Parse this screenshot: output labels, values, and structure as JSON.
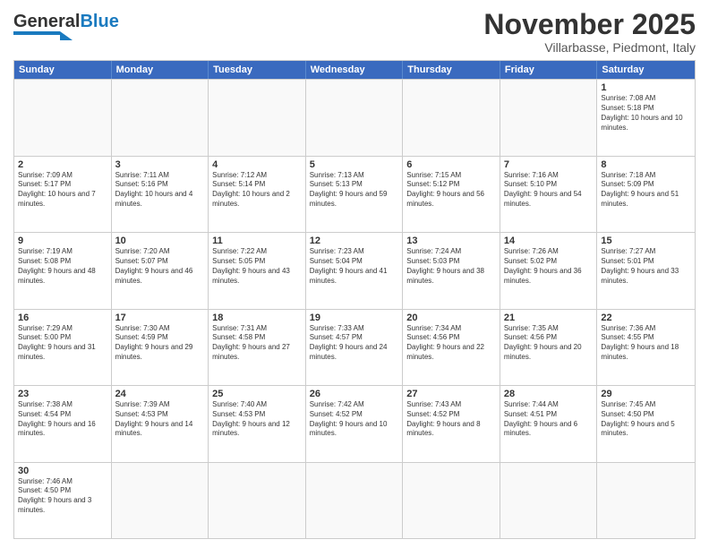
{
  "header": {
    "logo_text_general": "General",
    "logo_text_blue": "Blue",
    "month_title": "November 2025",
    "location": "Villarbasse, Piedmont, Italy"
  },
  "weekdays": [
    "Sunday",
    "Monday",
    "Tuesday",
    "Wednesday",
    "Thursday",
    "Friday",
    "Saturday"
  ],
  "weeks": [
    [
      {
        "day": "",
        "info": ""
      },
      {
        "day": "",
        "info": ""
      },
      {
        "day": "",
        "info": ""
      },
      {
        "day": "",
        "info": ""
      },
      {
        "day": "",
        "info": ""
      },
      {
        "day": "",
        "info": ""
      },
      {
        "day": "1",
        "info": "Sunrise: 7:08 AM\nSunset: 5:18 PM\nDaylight: 10 hours and 10 minutes."
      }
    ],
    [
      {
        "day": "2",
        "info": "Sunrise: 7:09 AM\nSunset: 5:17 PM\nDaylight: 10 hours and 7 minutes."
      },
      {
        "day": "3",
        "info": "Sunrise: 7:11 AM\nSunset: 5:16 PM\nDaylight: 10 hours and 4 minutes."
      },
      {
        "day": "4",
        "info": "Sunrise: 7:12 AM\nSunset: 5:14 PM\nDaylight: 10 hours and 2 minutes."
      },
      {
        "day": "5",
        "info": "Sunrise: 7:13 AM\nSunset: 5:13 PM\nDaylight: 9 hours and 59 minutes."
      },
      {
        "day": "6",
        "info": "Sunrise: 7:15 AM\nSunset: 5:12 PM\nDaylight: 9 hours and 56 minutes."
      },
      {
        "day": "7",
        "info": "Sunrise: 7:16 AM\nSunset: 5:10 PM\nDaylight: 9 hours and 54 minutes."
      },
      {
        "day": "8",
        "info": "Sunrise: 7:18 AM\nSunset: 5:09 PM\nDaylight: 9 hours and 51 minutes."
      }
    ],
    [
      {
        "day": "9",
        "info": "Sunrise: 7:19 AM\nSunset: 5:08 PM\nDaylight: 9 hours and 48 minutes."
      },
      {
        "day": "10",
        "info": "Sunrise: 7:20 AM\nSunset: 5:07 PM\nDaylight: 9 hours and 46 minutes."
      },
      {
        "day": "11",
        "info": "Sunrise: 7:22 AM\nSunset: 5:05 PM\nDaylight: 9 hours and 43 minutes."
      },
      {
        "day": "12",
        "info": "Sunrise: 7:23 AM\nSunset: 5:04 PM\nDaylight: 9 hours and 41 minutes."
      },
      {
        "day": "13",
        "info": "Sunrise: 7:24 AM\nSunset: 5:03 PM\nDaylight: 9 hours and 38 minutes."
      },
      {
        "day": "14",
        "info": "Sunrise: 7:26 AM\nSunset: 5:02 PM\nDaylight: 9 hours and 36 minutes."
      },
      {
        "day": "15",
        "info": "Sunrise: 7:27 AM\nSunset: 5:01 PM\nDaylight: 9 hours and 33 minutes."
      }
    ],
    [
      {
        "day": "16",
        "info": "Sunrise: 7:29 AM\nSunset: 5:00 PM\nDaylight: 9 hours and 31 minutes."
      },
      {
        "day": "17",
        "info": "Sunrise: 7:30 AM\nSunset: 4:59 PM\nDaylight: 9 hours and 29 minutes."
      },
      {
        "day": "18",
        "info": "Sunrise: 7:31 AM\nSunset: 4:58 PM\nDaylight: 9 hours and 27 minutes."
      },
      {
        "day": "19",
        "info": "Sunrise: 7:33 AM\nSunset: 4:57 PM\nDaylight: 9 hours and 24 minutes."
      },
      {
        "day": "20",
        "info": "Sunrise: 7:34 AM\nSunset: 4:56 PM\nDaylight: 9 hours and 22 minutes."
      },
      {
        "day": "21",
        "info": "Sunrise: 7:35 AM\nSunset: 4:56 PM\nDaylight: 9 hours and 20 minutes."
      },
      {
        "day": "22",
        "info": "Sunrise: 7:36 AM\nSunset: 4:55 PM\nDaylight: 9 hours and 18 minutes."
      }
    ],
    [
      {
        "day": "23",
        "info": "Sunrise: 7:38 AM\nSunset: 4:54 PM\nDaylight: 9 hours and 16 minutes."
      },
      {
        "day": "24",
        "info": "Sunrise: 7:39 AM\nSunset: 4:53 PM\nDaylight: 9 hours and 14 minutes."
      },
      {
        "day": "25",
        "info": "Sunrise: 7:40 AM\nSunset: 4:53 PM\nDaylight: 9 hours and 12 minutes."
      },
      {
        "day": "26",
        "info": "Sunrise: 7:42 AM\nSunset: 4:52 PM\nDaylight: 9 hours and 10 minutes."
      },
      {
        "day": "27",
        "info": "Sunrise: 7:43 AM\nSunset: 4:52 PM\nDaylight: 9 hours and 8 minutes."
      },
      {
        "day": "28",
        "info": "Sunrise: 7:44 AM\nSunset: 4:51 PM\nDaylight: 9 hours and 6 minutes."
      },
      {
        "day": "29",
        "info": "Sunrise: 7:45 AM\nSunset: 4:50 PM\nDaylight: 9 hours and 5 minutes."
      }
    ],
    [
      {
        "day": "30",
        "info": "Sunrise: 7:46 AM\nSunset: 4:50 PM\nDaylight: 9 hours and 3 minutes."
      },
      {
        "day": "",
        "info": ""
      },
      {
        "day": "",
        "info": ""
      },
      {
        "day": "",
        "info": ""
      },
      {
        "day": "",
        "info": ""
      },
      {
        "day": "",
        "info": ""
      },
      {
        "day": "",
        "info": ""
      }
    ]
  ]
}
